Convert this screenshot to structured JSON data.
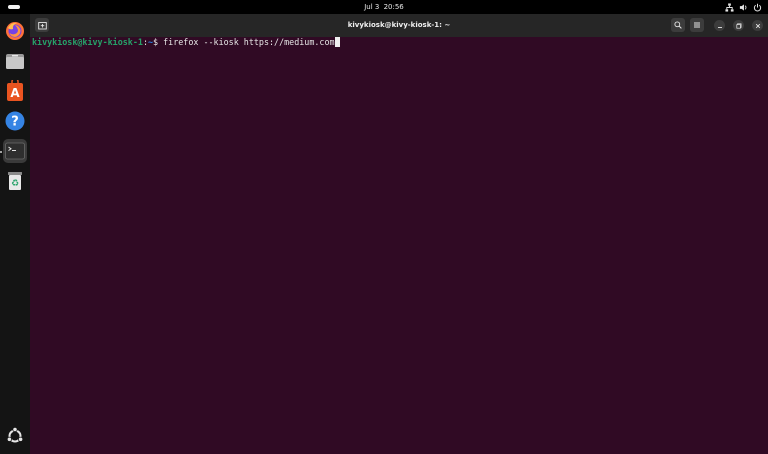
{
  "topbar": {
    "date": "Jul 3",
    "time": "20:56",
    "tray_icons": [
      "network-icon",
      "volume-icon",
      "power-icon"
    ]
  },
  "dock": {
    "items": [
      {
        "name": "Firefox",
        "icon": "firefox-icon"
      },
      {
        "name": "Files",
        "icon": "files-icon"
      },
      {
        "name": "App Center",
        "icon": "app-center-icon"
      },
      {
        "name": "Help",
        "icon": "help-icon"
      },
      {
        "name": "Terminal",
        "icon": "terminal-icon",
        "active": true
      },
      {
        "name": "Trash",
        "icon": "trash-icon"
      }
    ],
    "show_apps_icon": "ubuntu-logo-icon"
  },
  "window": {
    "title": "kivykiosk@kivy-kiosk-1: ~",
    "colors": {
      "background": "#300a24",
      "titlebar": "#262626",
      "user": "#26a269",
      "path": "#2a7bde"
    }
  },
  "terminal": {
    "prompt_user": "kivykiosk@kivy-kiosk-1",
    "prompt_sep": ":",
    "prompt_path": "~",
    "prompt_symbol": "$ ",
    "command": "firefox --kiosk https://medium.com"
  }
}
